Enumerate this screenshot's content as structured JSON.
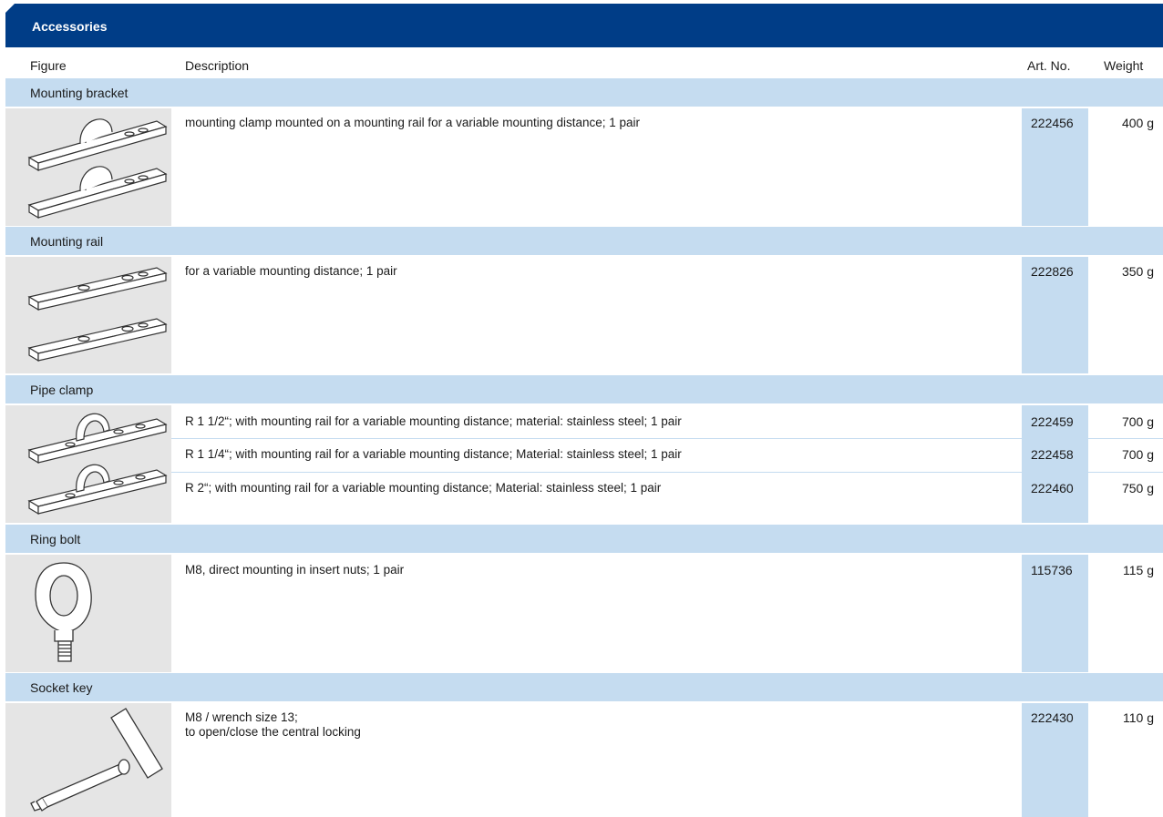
{
  "header": {
    "title": "Accessories"
  },
  "columns": {
    "figure": "Figure",
    "description": "Description",
    "art_no": "Art. No.",
    "weight": "Weight"
  },
  "groups": [
    {
      "name": "Mounting bracket",
      "items": [
        {
          "description": "mounting clamp mounted on a mounting rail for a variable mounting distance; 1 pair",
          "art_no": "222456",
          "weight": "400 g"
        }
      ]
    },
    {
      "name": "Mounting rail",
      "items": [
        {
          "description": "for a variable mounting distance; 1 pair",
          "art_no": "222826",
          "weight": "350 g"
        }
      ]
    },
    {
      "name": "Pipe clamp",
      "items": [
        {
          "description": "R 1 1/2“; with mounting rail for a variable mounting distance; material: stainless steel; 1 pair",
          "art_no": "222459",
          "weight": "700 g"
        },
        {
          "description": "R 1 1/4“; with mounting rail for a variable mounting distance; Material: stainless steel; 1 pair",
          "art_no": "222458",
          "weight": "700 g"
        },
        {
          "description": "R 2“; with mounting rail for a variable mounting distance; Material: stainless steel; 1 pair",
          "art_no": "222460",
          "weight": "750 g"
        }
      ]
    },
    {
      "name": "Ring bolt",
      "items": [
        {
          "description": "M8, direct mounting in insert nuts; 1 pair",
          "art_no": "115736",
          "weight": "115 g"
        }
      ]
    },
    {
      "name": "Socket key",
      "items": [
        {
          "description_line1": "M8 / wrench size 13;",
          "description_line2": "to open/close the central locking",
          "art_no": "222430",
          "weight": "110 g"
        }
      ]
    }
  ],
  "icons": [
    "mounting-bracket-icon",
    "mounting-rail-icon",
    "pipe-clamp-icon",
    "ring-bolt-icon",
    "socket-key-icon"
  ],
  "colors": {
    "banner": "#003d87",
    "group_bar": "#c5dcf0",
    "figure_bg": "#e5e5e5",
    "art_no_column": "#c5dcf0"
  }
}
